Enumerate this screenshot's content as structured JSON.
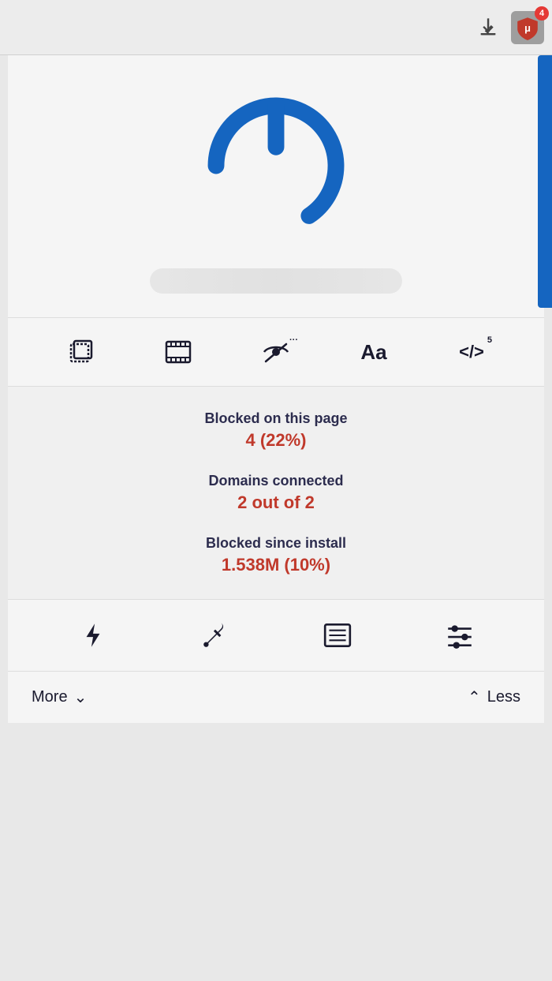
{
  "topbar": {
    "badge_count": "4"
  },
  "toolbar": {
    "items": [
      {
        "name": "layers-icon",
        "label": ""
      },
      {
        "name": "film-icon",
        "label": ""
      },
      {
        "name": "eye-slash-icon",
        "label": ""
      },
      {
        "name": "typography-icon",
        "label": "Aa"
      },
      {
        "name": "code-icon",
        "label": "</>",
        "badge": "5"
      }
    ]
  },
  "stats": {
    "blocked_label": "Blocked on this page",
    "blocked_value": "4 (22%)",
    "domains_label": "Domains connected",
    "domains_value": "2 out of 2",
    "since_install_label": "Blocked since install",
    "since_install_value": "1.538M (10%)"
  },
  "bottom_toolbar": {
    "items": [
      {
        "name": "lightning-icon"
      },
      {
        "name": "eyedropper-icon"
      },
      {
        "name": "list-icon"
      },
      {
        "name": "sliders-icon"
      }
    ]
  },
  "footer": {
    "more_label": "More",
    "less_label": "Less"
  }
}
